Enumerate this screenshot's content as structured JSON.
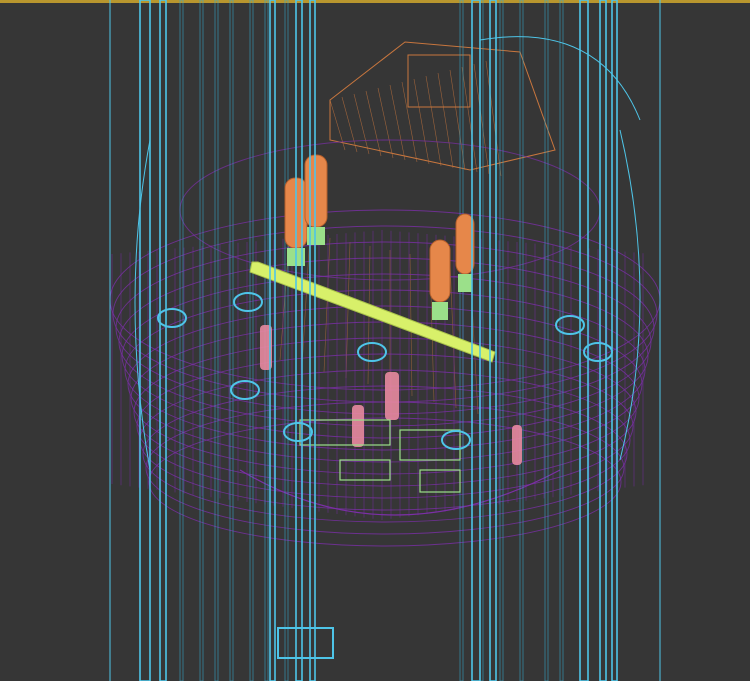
{
  "viewport": {
    "background": "#363636",
    "border_color": "#b8962e",
    "render_mode": "wireframe"
  },
  "colors": {
    "columns": "#4ec5e8",
    "columns_thin": "#35a9cc",
    "outer_cage": "#6a2d8f",
    "cage_rings": "#7b2fa6",
    "box": "#c8763e",
    "canisters": "#e6874a",
    "rail": "#d8f06a",
    "small_parts": "#e88aa0",
    "green_parts": "#9be08a"
  }
}
